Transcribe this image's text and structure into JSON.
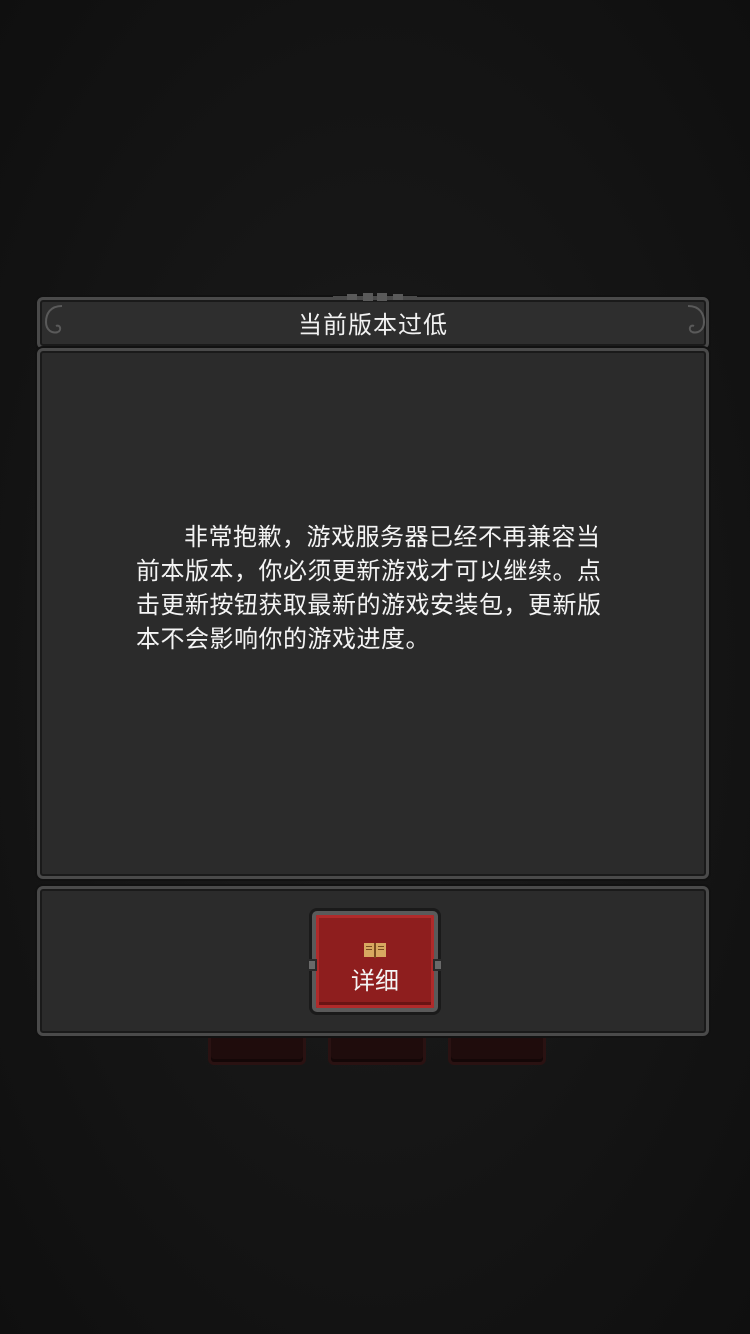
{
  "dialog": {
    "title": "当前版本过低",
    "message": "非常抱歉，游戏服务器已经不再兼容当前本版本，你必须更新游戏才可以继续。点击更新按钮获取最新的游戏安装包，更新版本不会影响你的游戏进度。"
  },
  "buttons": {
    "detail_label": "详细",
    "detail_icon": "book-icon"
  },
  "colors": {
    "panel": "#2b2b2b",
    "panel_border": "#4a4a4a",
    "button_red": "#8e1e1e",
    "text": "#f4f4f4"
  }
}
